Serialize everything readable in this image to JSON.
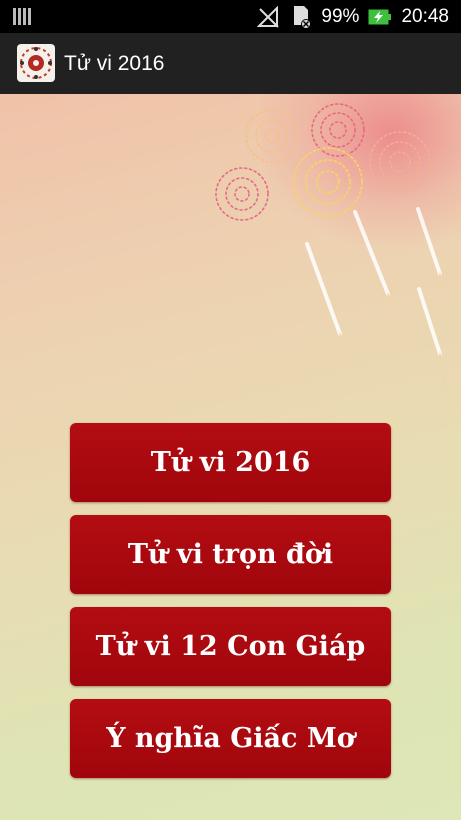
{
  "status_bar": {
    "battery_percent": "99%",
    "time": "20:48",
    "icons": [
      "signal-bars-icon",
      "no-signal-icon",
      "sd-card-icon",
      "battery-charging-icon"
    ]
  },
  "action_bar": {
    "title": "Tử vi 2016",
    "icon": "app-logo-icon"
  },
  "menu": {
    "buttons": [
      {
        "label": "Tử vi 2016"
      },
      {
        "label": "Tử vi trọn đời"
      },
      {
        "label": "Tử vi 12 Con Giáp"
      },
      {
        "label": "Ý nghĩa Giấc Mơ"
      }
    ]
  },
  "colors": {
    "button_bg": "#a80910",
    "action_bar_bg": "#212121",
    "status_bar_bg": "#000000",
    "battery_green": "#3fbf3f"
  }
}
